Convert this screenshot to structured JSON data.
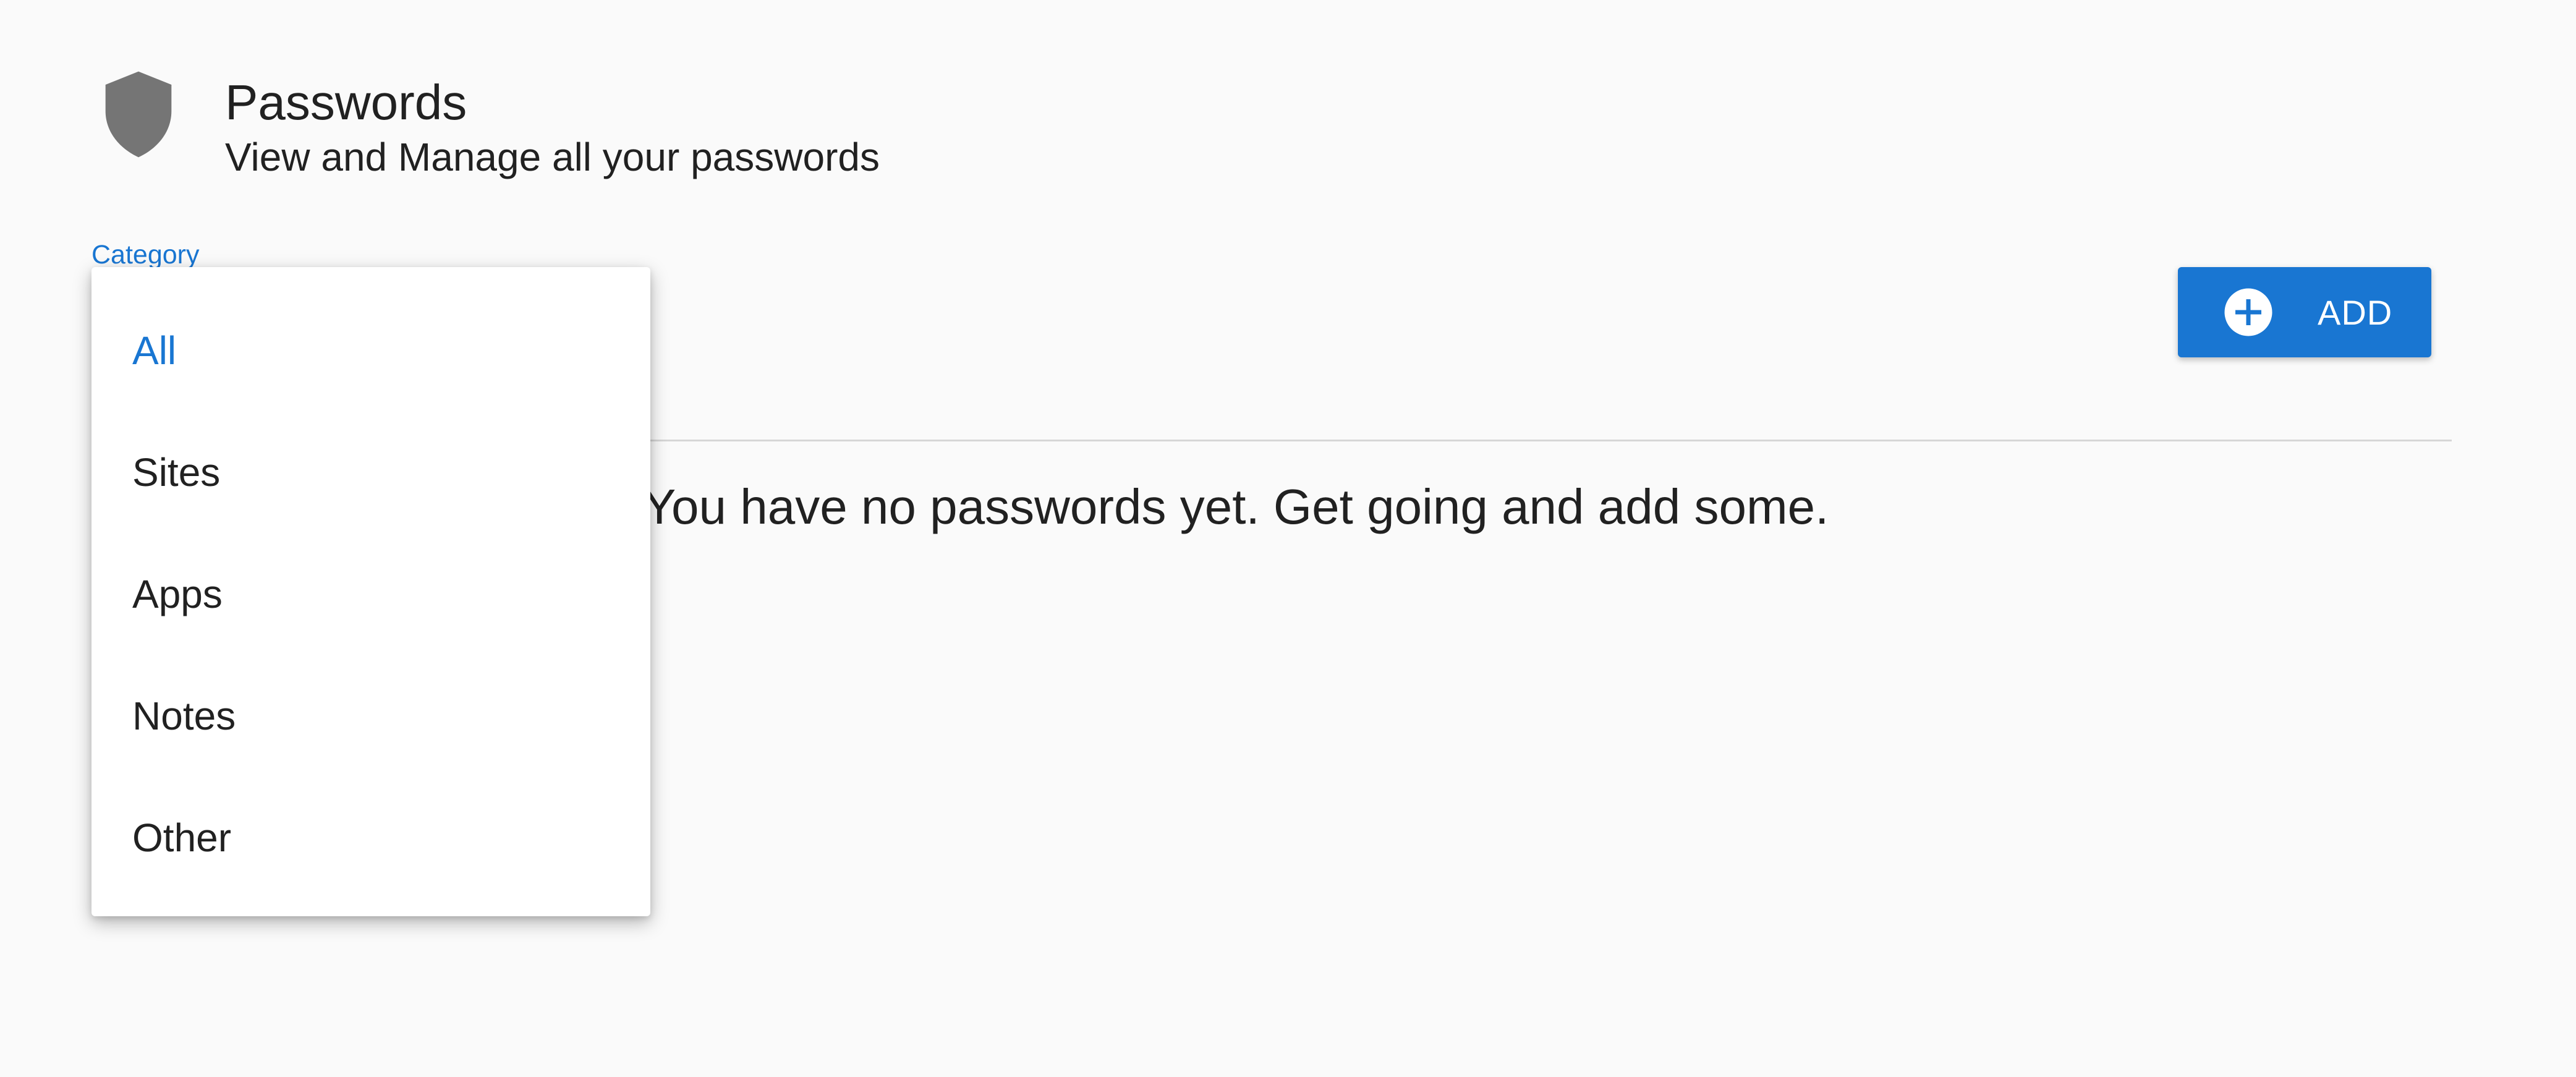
{
  "header": {
    "title": "Passwords",
    "subtitle": "View and Manage all your passwords",
    "icon": "shield-icon"
  },
  "filter": {
    "label": "Category",
    "selected": "All",
    "options": [
      "All",
      "Sites",
      "Apps",
      "Notes",
      "Other"
    ]
  },
  "toolbar": {
    "add_label": "ADD",
    "add_icon": "plus-circle-icon"
  },
  "empty_state": {
    "message": "You have no passwords yet. Get going and add some."
  },
  "colors": {
    "accent": "#1976d2",
    "background": "#fafafa",
    "icon_gray": "#757575"
  }
}
